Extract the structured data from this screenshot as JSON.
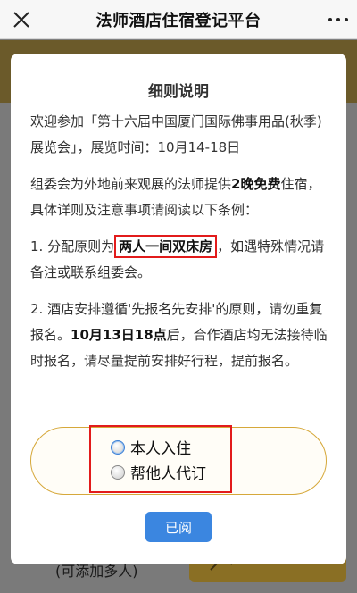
{
  "navbar": {
    "title": "法师酒店住宿登记平台",
    "close_icon": "close-icon",
    "more_icon": "more-icon"
  },
  "background": {
    "add_text": "(可添加多人)"
  },
  "modal": {
    "title": "细则说明",
    "p1": "欢迎参加「第十六届中国厦门国际佛事用品(秋季)展览会」，展览时间：10月14-18日",
    "p2_a": "组委会为外地前来观展的法师提供",
    "p2_b": "2晚免费",
    "p2_c": "住宿，具体详则及注意事项请阅读以下条例：",
    "p3_a": "1. 分配原则为",
    "p3_b": "两人一间双床房",
    "p3_c": "，如遇特殊情况请备注或联系组委会。",
    "p4_a": "2. 酒店安排遵循'先报名先安排'的原则，请勿重复报名。",
    "p4_b": "10月13日18点",
    "p4_c": "后，合作酒店均无法接待临时报名，请尽量提前安排好行程，提前报名。"
  },
  "options": [
    {
      "label": "本人入住",
      "selected": true
    },
    {
      "label": "帮他人代订",
      "selected": false
    }
  ],
  "buttons": {
    "read": "已阅"
  },
  "colors": {
    "accent_gold": "#d6a83a",
    "primary_blue": "#3b86e0",
    "highlight_red": "#e21b1b"
  }
}
